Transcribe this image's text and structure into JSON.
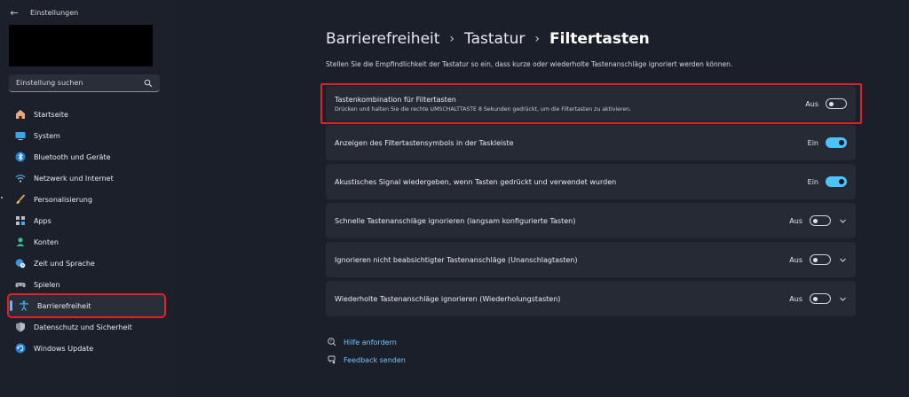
{
  "window": {
    "title": "Einstellungen"
  },
  "search": {
    "placeholder": "Einstellung suchen"
  },
  "sidebar": {
    "items": [
      {
        "label": "Startseite",
        "icon": "home-icon"
      },
      {
        "label": "System",
        "icon": "monitor-icon"
      },
      {
        "label": "Bluetooth und Geräte",
        "icon": "bluetooth-icon"
      },
      {
        "label": "Netzwerk und Internet",
        "icon": "wifi-icon"
      },
      {
        "label": "Personalisierung",
        "icon": "brush-icon"
      },
      {
        "label": "Apps",
        "icon": "apps-icon"
      },
      {
        "label": "Konten",
        "icon": "person-icon"
      },
      {
        "label": "Zeit und Sprache",
        "icon": "globe-clock-icon"
      },
      {
        "label": "Spielen",
        "icon": "gamepad-icon"
      },
      {
        "label": "Barrierefreiheit",
        "icon": "accessibility-icon",
        "active": true
      },
      {
        "label": "Datenschutz und Sicherheit",
        "icon": "shield-icon"
      },
      {
        "label": "Windows Update",
        "icon": "update-icon"
      }
    ]
  },
  "breadcrumb": {
    "level1": "Barrierefreiheit",
    "level2": "Tastatur",
    "current": "Filtertasten",
    "separator": "›"
  },
  "main": {
    "description": "Stellen Sie die Empfindlichkeit der Tastatur so ein, dass kurze oder wiederholte Tastenanschläge ignoriert werden können.",
    "settings": [
      {
        "title": "Tastenkombination für Filtertasten",
        "subtitle": "Drücken und halten Sie die rechte UMSCHALTTASTE 8 Sekunden gedrückt, um die Filtertasten zu aktivieren.",
        "state": "Aus",
        "on": false
      },
      {
        "title": "Anzeigen des Filtertastensymbols in der Taskleiste",
        "state": "Ein",
        "on": true
      },
      {
        "title": "Akustisches Signal wiedergeben, wenn Tasten gedrückt und verwendet wurden",
        "state": "Ein",
        "on": true
      },
      {
        "title": "Schnelle Tastenanschläge ignorieren (langsam konfigurierte Tasten)",
        "state": "Aus",
        "on": false,
        "expandable": true
      },
      {
        "title": "Ignorieren nicht beabsichtigter Tastenanschläge (Unanschlagtasten)",
        "state": "Aus",
        "on": false,
        "expandable": true
      },
      {
        "title": "Wiederholte Tastenanschläge ignorieren (Wiederholungstasten)",
        "state": "Aus",
        "on": false,
        "expandable": true
      }
    ]
  },
  "links": {
    "help": "Hilfe anfordern",
    "feedback": "Feedback senden"
  },
  "colors": {
    "accent": "#4cc2ff",
    "highlight": "#e0202b",
    "background": "#1b1f2a",
    "card": "#262a35"
  }
}
